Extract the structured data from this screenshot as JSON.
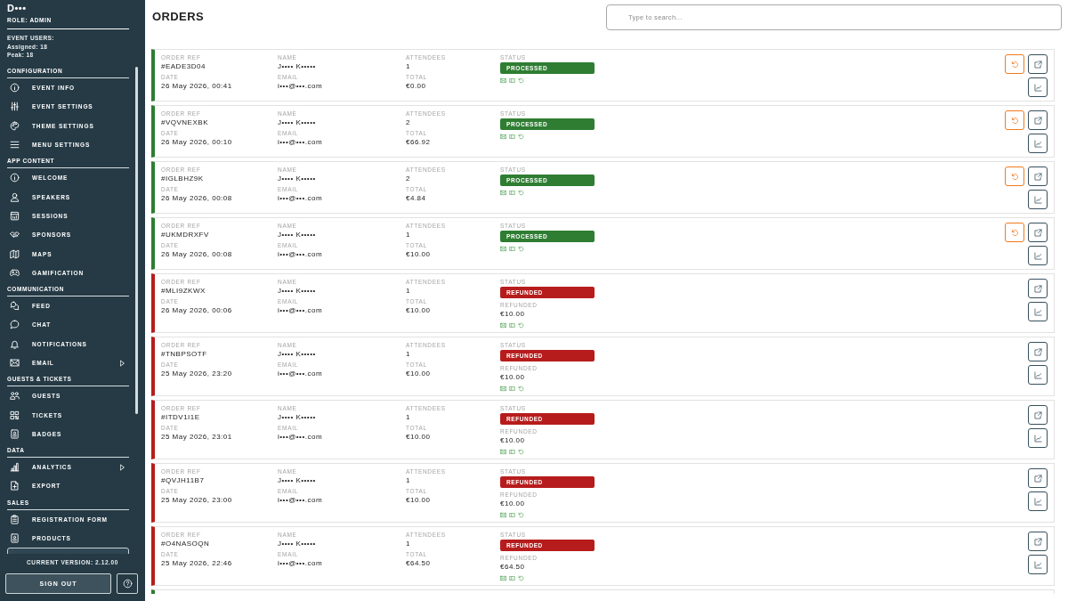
{
  "sidebar": {
    "title": "D•••",
    "role": "ROLE: ADMIN",
    "event_users": {
      "heading": "EVENT USERS:",
      "assigned": "Assigned: 18",
      "peak": "Peak: 18"
    },
    "sections": [
      {
        "title": "CONFIGURATION",
        "items": [
          {
            "label": "EVENT INFO",
            "submenu": false,
            "selected": false
          },
          {
            "label": "EVENT SETTINGS",
            "submenu": false,
            "selected": false
          },
          {
            "label": "THEME SETTINGS",
            "submenu": false,
            "selected": false
          },
          {
            "label": "MENU SETTINGS",
            "submenu": false,
            "selected": false
          }
        ]
      },
      {
        "title": "APP CONTENT",
        "items": [
          {
            "label": "WELCOME",
            "submenu": false,
            "selected": false
          },
          {
            "label": "SPEAKERS",
            "submenu": false,
            "selected": false
          },
          {
            "label": "SESSIONS",
            "submenu": false,
            "selected": false
          },
          {
            "label": "SPONSORS",
            "submenu": false,
            "selected": false
          },
          {
            "label": "MAPS",
            "submenu": false,
            "selected": false
          },
          {
            "label": "GAMIFICATION",
            "submenu": false,
            "selected": false
          }
        ]
      },
      {
        "title": "COMMUNICATION",
        "items": [
          {
            "label": "FEED",
            "submenu": false,
            "selected": false
          },
          {
            "label": "CHAT",
            "submenu": false,
            "selected": false
          },
          {
            "label": "NOTIFICATIONS",
            "submenu": false,
            "selected": false
          },
          {
            "label": "EMAIL",
            "submenu": true,
            "selected": false
          }
        ]
      },
      {
        "title": "GUESTS & TICKETS",
        "items": [
          {
            "label": "GUESTS",
            "submenu": false,
            "selected": false
          },
          {
            "label": "TICKETS",
            "submenu": false,
            "selected": false
          },
          {
            "label": "BADGES",
            "submenu": false,
            "selected": false
          }
        ]
      },
      {
        "title": "DATA",
        "items": [
          {
            "label": "ANALYTICS",
            "submenu": true,
            "selected": false
          },
          {
            "label": "EXPORT",
            "submenu": false,
            "selected": false
          }
        ]
      },
      {
        "title": "SALES",
        "items": [
          {
            "label": "REGISTRATION FORM",
            "submenu": false,
            "selected": false
          },
          {
            "label": "PRODUCTS",
            "submenu": false,
            "selected": false
          },
          {
            "submenu": false,
            "selected": true
          }
        ]
      }
    ],
    "version": "CURRENT VERSION: 2.12.00",
    "sign_out": "SIGN OUT"
  },
  "page": {
    "title": "ORDERS",
    "search": {
      "placeholder": "Type to search..."
    }
  },
  "orders": [
    {
      "kind": "processed",
      "refundable": true,
      "fields": [
        {
          "label": "ORDER REF",
          "value": "#EADE3D04"
        },
        {
          "label": "NAME",
          "value": "J•••• K•••••"
        },
        {
          "label": "ATTENDEES",
          "value": "1"
        },
        {
          "label": "DATE",
          "value": "26 May 2026, 00:41"
        },
        {
          "label": "EMAIL",
          "value": "i•••@•••.com"
        },
        {
          "label": "TOTAL",
          "value": "€0.00"
        }
      ],
      "status": {
        "label": "STATUS",
        "text": "PROCESSED"
      }
    },
    {
      "kind": "processed",
      "refundable": true,
      "fields": [
        {
          "label": "ORDER REF",
          "value": "#VQVNEXBK"
        },
        {
          "label": "NAME",
          "value": "J•••• K•••••"
        },
        {
          "label": "ATTENDEES",
          "value": "2"
        },
        {
          "label": "DATE",
          "value": "26 May 2026, 00:10"
        },
        {
          "label": "EMAIL",
          "value": "i•••@•••.com"
        },
        {
          "label": "TOTAL",
          "value": "€66.92"
        }
      ],
      "status": {
        "label": "STATUS",
        "text": "PROCESSED"
      }
    },
    {
      "kind": "processed",
      "refundable": true,
      "fields": [
        {
          "label": "ORDER REF",
          "value": "#IGLBHZ9K"
        },
        {
          "label": "NAME",
          "value": "J•••• K•••••"
        },
        {
          "label": "ATTENDEES",
          "value": "2"
        },
        {
          "label": "DATE",
          "value": "26 May 2026, 00:08"
        },
        {
          "label": "EMAIL",
          "value": "i•••@•••.com"
        },
        {
          "label": "TOTAL",
          "value": "€4.84"
        }
      ],
      "status": {
        "label": "STATUS",
        "text": "PROCESSED"
      }
    },
    {
      "kind": "processed",
      "refundable": true,
      "fields": [
        {
          "label": "ORDER REF",
          "value": "#UKMDRXFV"
        },
        {
          "label": "NAME",
          "value": "J•••• K•••••"
        },
        {
          "label": "ATTENDEES",
          "value": "1"
        },
        {
          "label": "DATE",
          "value": "26 May 2026, 00:08"
        },
        {
          "label": "EMAIL",
          "value": "i•••@•••.com"
        },
        {
          "label": "TOTAL",
          "value": "€10.00"
        }
      ],
      "status": {
        "label": "STATUS",
        "text": "PROCESSED"
      }
    },
    {
      "kind": "refunded",
      "refundable": false,
      "fields": [
        {
          "label": "ORDER REF",
          "value": "#MLI9ZKWX"
        },
        {
          "label": "NAME",
          "value": "J•••• K•••••"
        },
        {
          "label": "ATTENDEES",
          "value": "1"
        },
        {
          "label": "DATE",
          "value": "26 May 2026, 00:06"
        },
        {
          "label": "EMAIL",
          "value": "i•••@•••.com"
        },
        {
          "label": "TOTAL",
          "value": "€10.00"
        }
      ],
      "status": {
        "label": "STATUS",
        "text": "REFUNDED"
      },
      "refund": {
        "label": "REFUNDED",
        "amount": "€10.00"
      }
    },
    {
      "kind": "refunded",
      "refundable": false,
      "fields": [
        {
          "label": "ORDER REF",
          "value": "#TNBPSOTF"
        },
        {
          "label": "NAME",
          "value": "J•••• K•••••"
        },
        {
          "label": "ATTENDEES",
          "value": "1"
        },
        {
          "label": "DATE",
          "value": "25 May 2026, 23:20"
        },
        {
          "label": "EMAIL",
          "value": "i•••@•••.com"
        },
        {
          "label": "TOTAL",
          "value": "€10.00"
        }
      ],
      "status": {
        "label": "STATUS",
        "text": "REFUNDED"
      },
      "refund": {
        "label": "REFUNDED",
        "amount": "€10.00"
      }
    },
    {
      "kind": "refunded",
      "refundable": false,
      "fields": [
        {
          "label": "ORDER REF",
          "value": "#ITDV1I1E"
        },
        {
          "label": "NAME",
          "value": "J•••• K•••••"
        },
        {
          "label": "ATTENDEES",
          "value": "1"
        },
        {
          "label": "DATE",
          "value": "25 May 2026, 23:01"
        },
        {
          "label": "EMAIL",
          "value": "i•••@•••.com"
        },
        {
          "label": "TOTAL",
          "value": "€10.00"
        }
      ],
      "status": {
        "label": "STATUS",
        "text": "REFUNDED"
      },
      "refund": {
        "label": "REFUNDED",
        "amount": "€10.00"
      }
    },
    {
      "kind": "refunded",
      "refundable": false,
      "fields": [
        {
          "label": "ORDER REF",
          "value": "#QVJH11B7"
        },
        {
          "label": "NAME",
          "value": "J•••• K•••••"
        },
        {
          "label": "ATTENDEES",
          "value": "1"
        },
        {
          "label": "DATE",
          "value": "25 May 2026, 23:00"
        },
        {
          "label": "EMAIL",
          "value": "i•••@•••.com"
        },
        {
          "label": "TOTAL",
          "value": "€10.00"
        }
      ],
      "status": {
        "label": "STATUS",
        "text": "REFUNDED"
      },
      "refund": {
        "label": "REFUNDED",
        "amount": "€10.00"
      }
    },
    {
      "kind": "refunded",
      "refundable": false,
      "fields": [
        {
          "label": "ORDER REF",
          "value": "#O4NASOQN"
        },
        {
          "label": "NAME",
          "value": "J•••• K•••••"
        },
        {
          "label": "ATTENDEES",
          "value": "1"
        },
        {
          "label": "DATE",
          "value": "25 May 2026, 22:46"
        },
        {
          "label": "EMAIL",
          "value": "i•••@•••.com"
        },
        {
          "label": "TOTAL",
          "value": "€64.50"
        }
      ],
      "status": {
        "label": "STATUS",
        "text": "REFUNDED"
      },
      "refund": {
        "label": "REFUNDED",
        "amount": "€64.50"
      }
    },
    {
      "kind": "processed"
    }
  ]
}
